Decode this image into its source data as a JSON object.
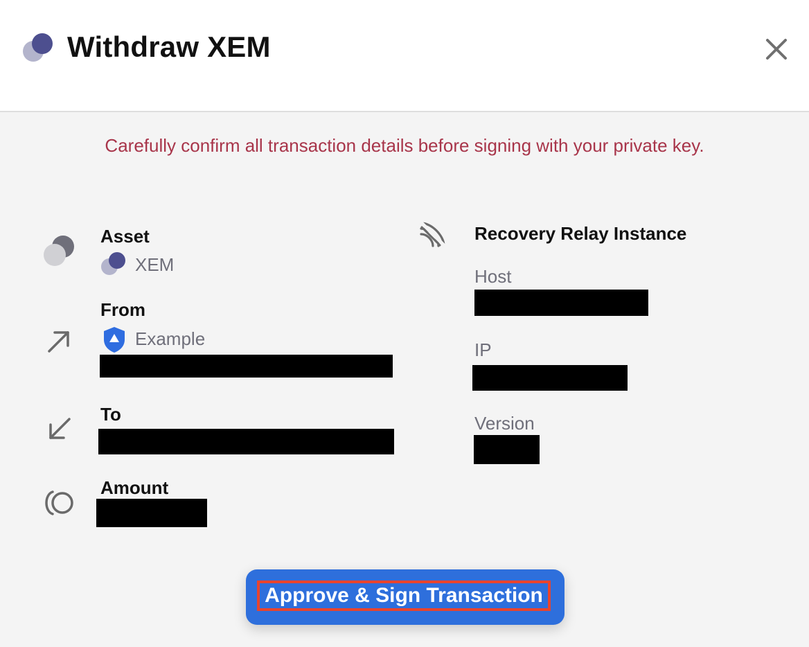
{
  "header": {
    "title": "Withdraw XEM",
    "logo_icon": "xem-coin-icon",
    "close_icon": "close-icon"
  },
  "warning": "Carefully confirm all transaction details before signing with your private key.",
  "details": {
    "asset": {
      "label": "Asset",
      "value": "XEM",
      "icon": "coins-icon"
    },
    "from": {
      "label": "From",
      "value": "Example",
      "account_icon": "shield-icon",
      "icon": "arrow-up-right-icon"
    },
    "to": {
      "label": "To",
      "icon": "arrow-down-left-icon"
    },
    "amount": {
      "label": "Amount",
      "icon": "coin-amount-icon"
    }
  },
  "relay": {
    "title": "Recovery Relay Instance",
    "icon": "signal-icon",
    "host_label": "Host",
    "ip_label": "IP",
    "version_label": "Version"
  },
  "actions": {
    "approve_label": "Approve & Sign Transaction"
  },
  "colors": {
    "warning": "#a8354a",
    "primary": "#2e6fdc",
    "highlight": "#e8442e",
    "coin_dark": "#4d4f8f",
    "coin_light": "#b3b4cc"
  }
}
